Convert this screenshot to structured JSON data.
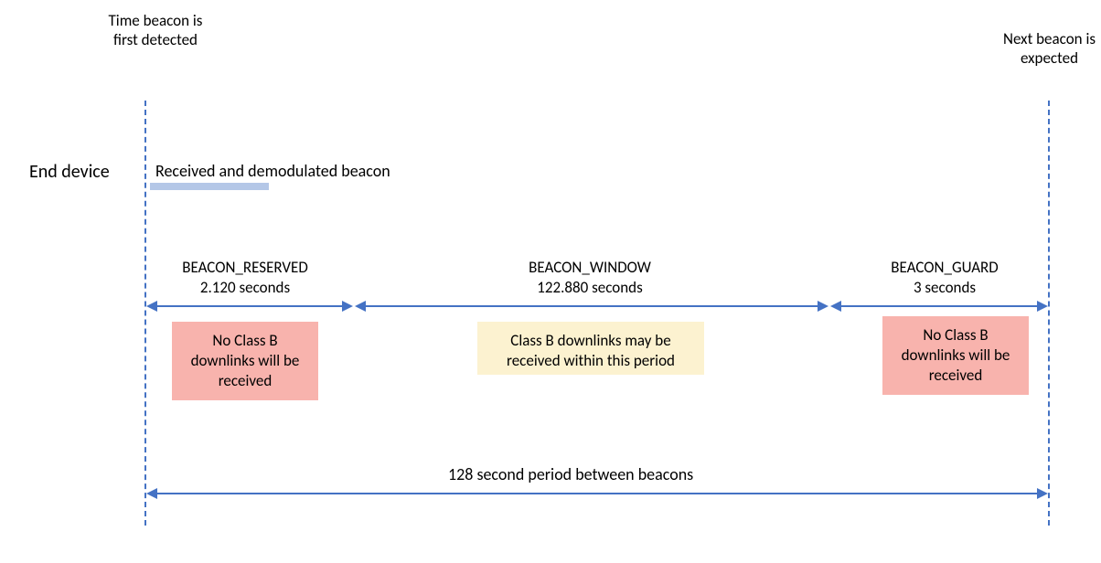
{
  "chart_data": {
    "type": "timeline",
    "title": "128 second period between beacons",
    "total_seconds": 128,
    "segments": [
      {
        "name": "BEACON_RESERVED",
        "seconds": 2.12,
        "downlinks": "No Class B downlinks will be received"
      },
      {
        "name": "BEACON_WINDOW",
        "seconds": 122.88,
        "downlinks": "Class B downlinks may be received within this period"
      },
      {
        "name": "BEACON_GUARD",
        "seconds": 3,
        "downlinks": "No Class B downlinks will be received"
      }
    ]
  },
  "top_labels": {
    "left": "Time beacon is first detected",
    "right": "Next beacon is expected"
  },
  "side_label": "End device",
  "received_label": "Received and demodulated beacon",
  "segments": {
    "reserved": {
      "title": "BEACON_RESERVED",
      "duration": "2.120 seconds",
      "box_text": "No Class B downlinks will be received"
    },
    "window": {
      "title": "BEACON_WINDOW",
      "duration": "122.880 seconds",
      "box_text": "Class B downlinks may be received within this period"
    },
    "guard": {
      "title": "BEACON_GUARD",
      "duration": "3 seconds",
      "box_text": "No Class B downlinks will be received"
    }
  },
  "bottom_label": "128 second period between beacons"
}
